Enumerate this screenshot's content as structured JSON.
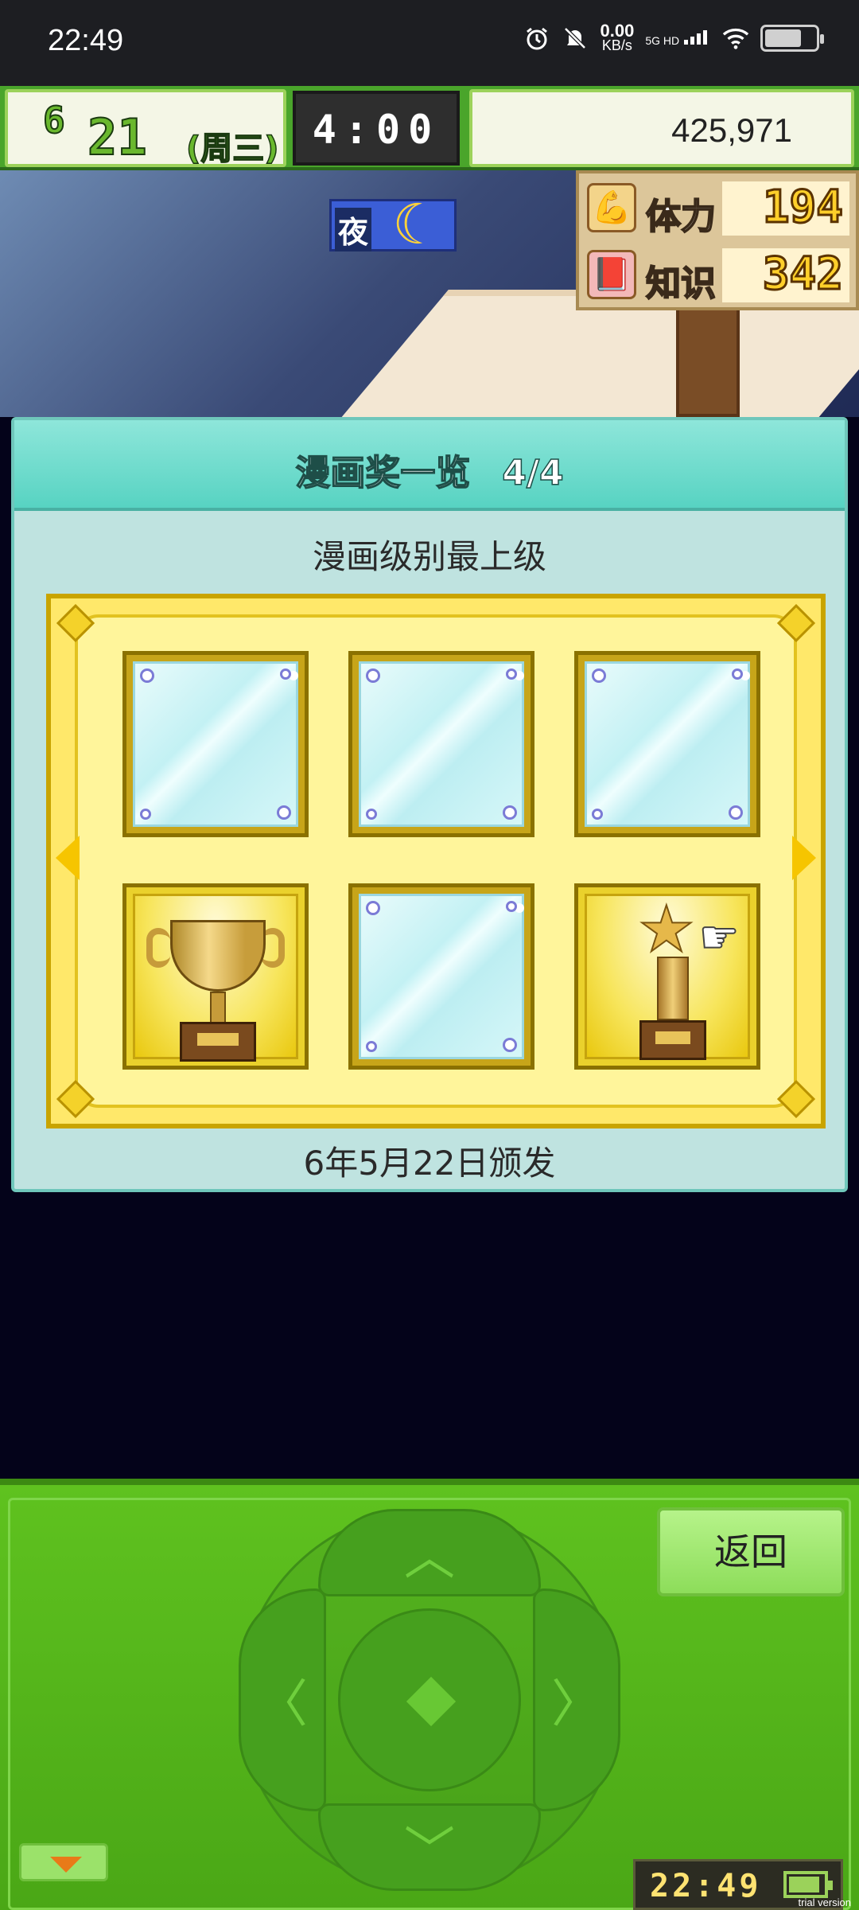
{
  "status_bar": {
    "time": "22:49",
    "net_speed_value": "0.00",
    "net_speed_unit": "KB/s",
    "network_label": "5G HD"
  },
  "game_header": {
    "month": "6",
    "day": "21",
    "weekday": "(周三)",
    "clock": "4:00",
    "money": "425,971"
  },
  "scene": {
    "time_of_day": "夜",
    "stats": [
      {
        "label": "体力",
        "value": "194",
        "icon": "flexed-arm-icon"
      },
      {
        "label": "知识",
        "value": "342",
        "icon": "book-icon"
      }
    ]
  },
  "award_dialog": {
    "title": "漫画奖一览",
    "page_counter": "4/4",
    "subtitle": "漫画级别最上级",
    "footer": "6年5月22日颁发",
    "slots": [
      {
        "state": "empty"
      },
      {
        "state": "empty"
      },
      {
        "state": "empty"
      },
      {
        "state": "trophy-cup"
      },
      {
        "state": "empty"
      },
      {
        "state": "star-trophy",
        "selected": true
      }
    ]
  },
  "controller": {
    "back_label": "返回",
    "clock": "22:49"
  },
  "watermark": "trial version",
  "colors": {
    "game_green": "#4aa52b",
    "dialog_teal": "#57d3c2",
    "frame_gold": "#ffe86a",
    "stat_number_yellow": "#ffcf2a"
  }
}
